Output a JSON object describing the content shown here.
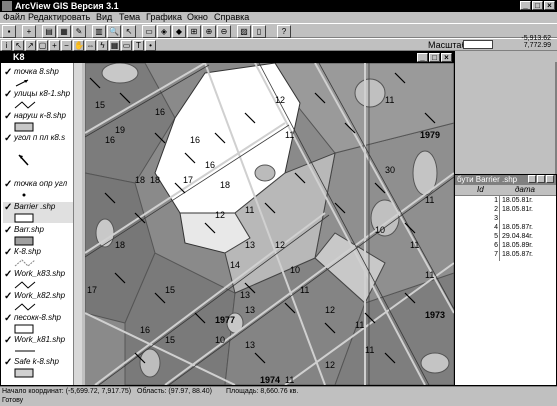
{
  "app": {
    "title": "ArcView GIS Версия 3.1"
  },
  "menu": [
    "Файл",
    "Редактировать",
    "Вид",
    "Тема",
    "Графика",
    "Окно",
    "Справка"
  ],
  "toolbar": {
    "scale_label": "Масштаб",
    "coord_x": "-5,913.62",
    "coord_y": "7,772.99"
  },
  "view": {
    "title": "K8"
  },
  "layers": [
    {
      "name": "точка 8.shp"
    },
    {
      "name": "улицы к8-1.shp"
    },
    {
      "name": "наруш к-8.shp"
    },
    {
      "name": "угол п пл к8.s"
    },
    {
      "name": "точка опр угл"
    },
    {
      "name": "Barrier .shp"
    },
    {
      "name": "Barr.shp"
    },
    {
      "name": "К-8.shp"
    },
    {
      "name": "Work_k83.shp"
    },
    {
      "name": "Work_k82.shp"
    },
    {
      "name": "песокк-8.shp"
    },
    {
      "name": "Work_k81.shp"
    },
    {
      "name": "Safe k-8.shp"
    }
  ],
  "map_labels": [
    "16",
    "15",
    "19",
    "16",
    "12",
    "11",
    "18",
    "18",
    "17",
    "18",
    "11",
    "13",
    "14",
    "12",
    "10",
    "11",
    "18",
    "16",
    "13",
    "12",
    "15",
    "11",
    "13",
    "11",
    "12",
    "10",
    "11",
    "11",
    "16",
    "12",
    "11",
    "10",
    "11",
    "16",
    "1977",
    "1979",
    "1973",
    "1974",
    "30",
    "15",
    "17",
    "13",
    "11"
  ],
  "table": {
    "title": "бути Barrier .shp",
    "columns": [
      "Id",
      "дата"
    ],
    "rows": [
      {
        "id": "1",
        "date": "18.05.81г."
      },
      {
        "id": "2",
        "date": "18.05.81г."
      },
      {
        "id": "3",
        "date": ""
      },
      {
        "id": "4",
        "date": "18.05.87г."
      },
      {
        "id": "5",
        "date": "29.04.84г."
      },
      {
        "id": "6",
        "date": "18.05.89г."
      },
      {
        "id": "7",
        "date": "18.05.87г."
      }
    ]
  },
  "status": {
    "start_label": "Начало координат: (-5,699.72, 7,917.75)",
    "area_label": "Область: (97.97, 88.40)",
    "square_label": "Площадь: 8,660.76 кв.",
    "ready": "Готову"
  }
}
